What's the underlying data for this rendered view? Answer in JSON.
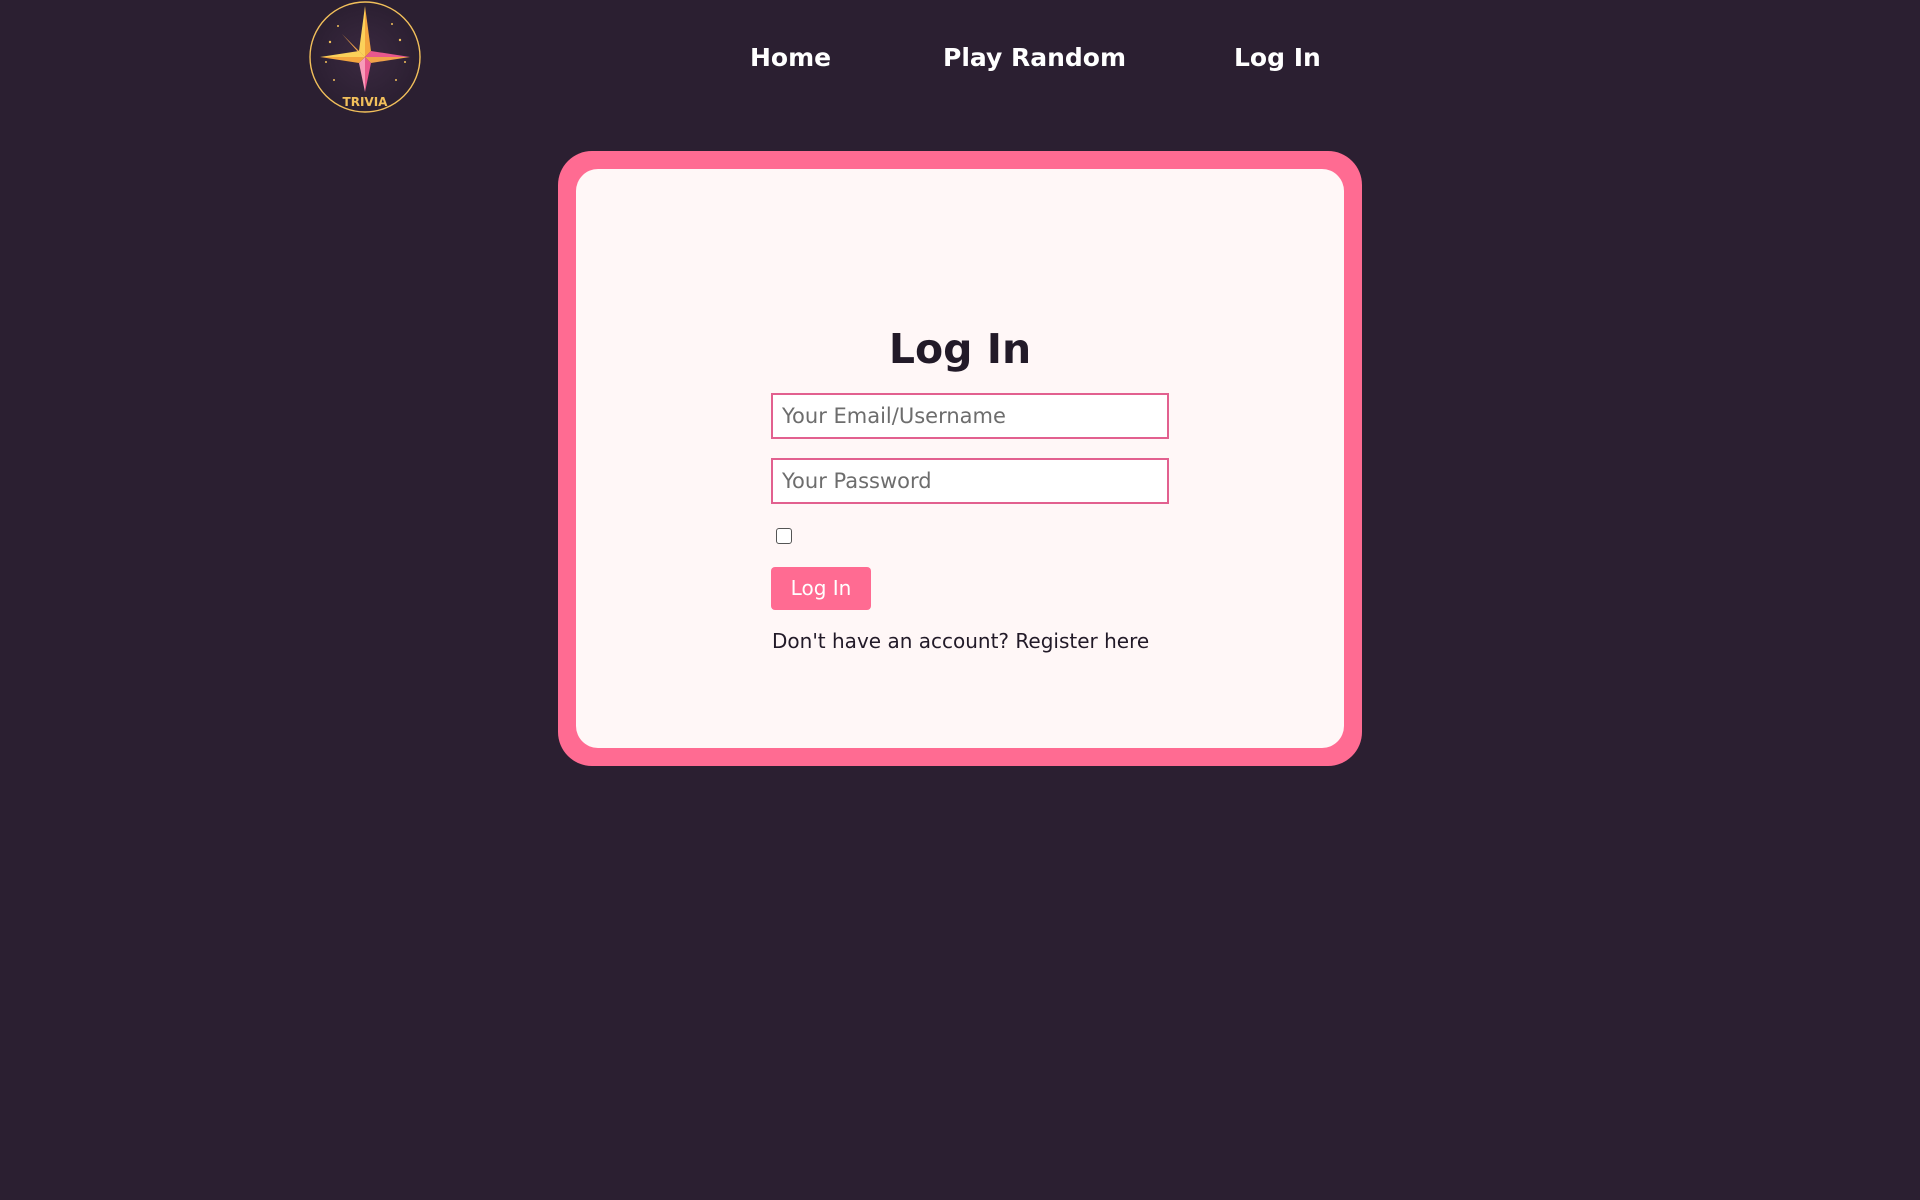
{
  "logo": {
    "text": "TRIVIA",
    "icon": "star-compass-icon",
    "colors": {
      "gold": "#f7c24a",
      "pink": "#ef5a8f",
      "ring": "#f2c05b",
      "background": "#2b1f31"
    }
  },
  "nav": {
    "home": "Home",
    "play_random": "Play Random",
    "log_in": "Log In"
  },
  "login_card": {
    "title": "Log In",
    "email_placeholder": "Your Email/Username",
    "email_value": "",
    "password_placeholder": "Your Password",
    "password_value": "",
    "remember_checked": false,
    "submit_label": "Log In",
    "register_prompt": "Don't have an account?",
    "register_link": "Register here"
  },
  "theme": {
    "page_background": "#2b1f31",
    "accent": "#ff6b92",
    "card_background": "#fff7f7",
    "text_dark": "#221a28"
  }
}
